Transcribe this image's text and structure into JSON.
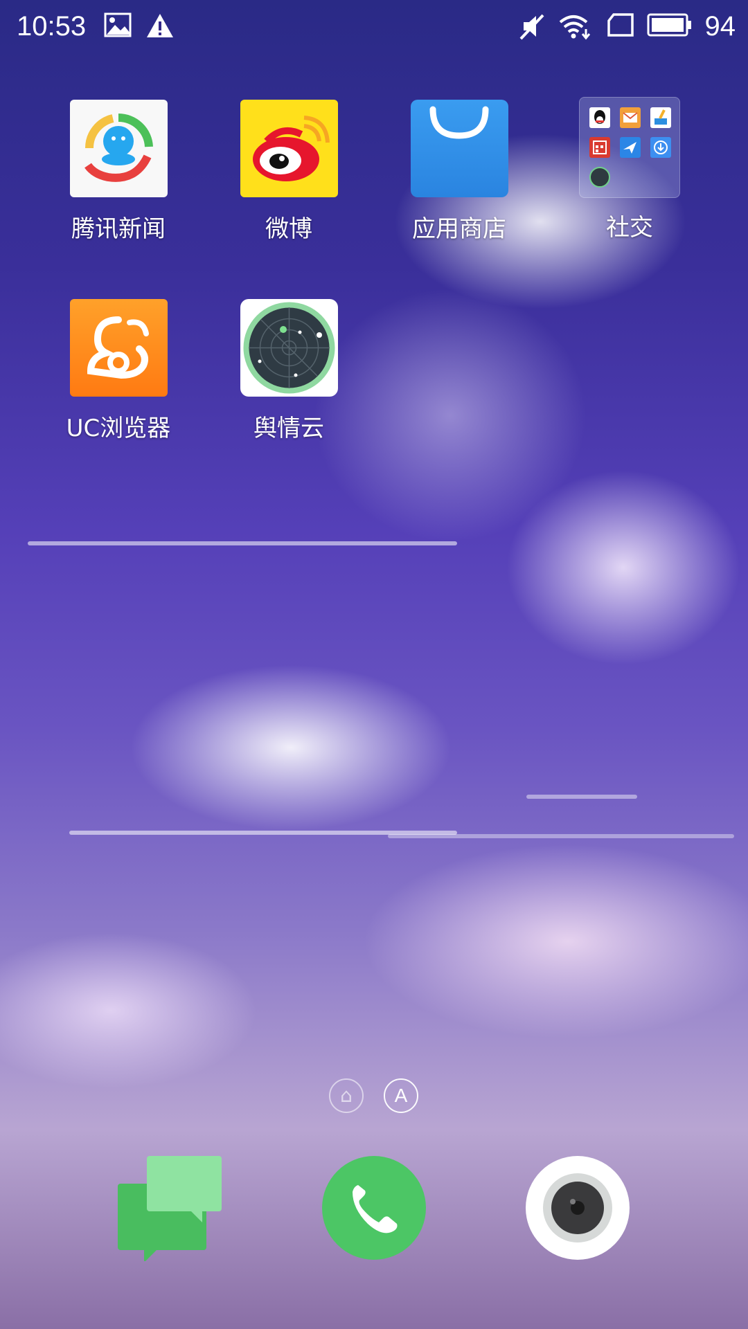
{
  "status_bar": {
    "time": "10:53",
    "left_icons": [
      "image-icon",
      "warning-icon"
    ],
    "right_icons": [
      "mute-icon",
      "wifi-icon",
      "sim-card-icon",
      "battery-icon"
    ],
    "battery_level": "94"
  },
  "apps": [
    {
      "label": "腾讯新闻",
      "icon": "tencent-news-icon"
    },
    {
      "label": "微博",
      "icon": "weibo-icon"
    },
    {
      "label": "应用商店",
      "icon": "app-store-icon"
    },
    {
      "label": "社交",
      "icon": "folder-icon"
    },
    {
      "label": "UC浏览器",
      "icon": "uc-browser-icon"
    },
    {
      "label": "舆情云",
      "icon": "radar-icon"
    }
  ],
  "folder_items": [
    "qq-icon",
    "mail-icon",
    "cleaner-icon",
    "calendar-icon",
    "bird-icon",
    "download-icon",
    "radar-mini-icon"
  ],
  "page_indicator": {
    "home_glyph": "⌂",
    "letter": "A",
    "active": "A"
  },
  "dock": [
    {
      "name": "messages",
      "icon": "chat-bubbles-icon"
    },
    {
      "name": "phone",
      "icon": "phone-icon"
    },
    {
      "name": "camera",
      "icon": "camera-icon"
    }
  ],
  "colors": {
    "weibo_bg": "#ffe01b",
    "uc_bg": "#ff8a18",
    "appstore_bg": "#2f8de8",
    "phone_green": "#4cc665",
    "messages_green": "#5ccd72"
  }
}
